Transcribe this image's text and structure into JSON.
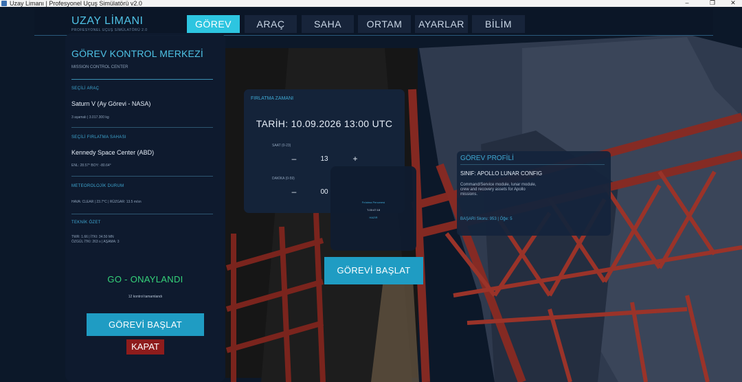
{
  "window": {
    "title": "Uzay Limanı | Profesyonel Uçuş Simülatörü v2.0",
    "controls": {
      "minimize": "–",
      "maximize": "❐",
      "close": "✕"
    }
  },
  "brand": {
    "name": "UZAY LİMANI",
    "subtitle": "PROFESYONEL UÇUŞ SİMÜLATÖRÜ 2.0"
  },
  "nav": {
    "tabs": [
      {
        "label": "GÖREV",
        "active": true
      },
      {
        "label": "ARAÇ",
        "active": false
      },
      {
        "label": "SAHA",
        "active": false
      },
      {
        "label": "ORTAM",
        "active": false
      },
      {
        "label": "AYARLAR",
        "active": false
      },
      {
        "label": "BİLİM",
        "active": false
      }
    ]
  },
  "mission_control": {
    "title": "GÖREV KONTROL MERKEZİ",
    "subtitle": "MISSION CONTROL CENTER",
    "sections": [
      {
        "label": "SEÇİLİ ARAÇ",
        "value": "Saturn V (Ay Görevi - NASA)",
        "detail": "3 aşamalı  |  3.017.300 kg"
      },
      {
        "label": "SEÇİLİ FIRLATMA SAHASI",
        "value": "Kennedy Space Center (ABD)",
        "detail": "ENL: 28.57°  BOY: -80.64°"
      },
      {
        "label": "METEOROLOJİK DURUM",
        "value": "",
        "detail": "HAVA: CLEAR  |  23.7°C  |  RÜZGAR: 13.5 m/sn"
      },
      {
        "label": "TEKNİK ÖZET",
        "value": "",
        "detail": "TWR: 1.66  |  İTKI: 34.50 MN",
        "detail2": "ÖZGÜL İTKI: 263 s  |  AŞAMA: 3"
      }
    ],
    "status": "GO - ONAYLANDI",
    "checks": "12 kontrol tamamlandı",
    "start_button": "GÖREVİ BAŞLAT",
    "close_button": "KAPAT"
  },
  "launch_time": {
    "label": "FIRLATMA ZAMANI",
    "date_text": "TARİH:  10.09.2026  13:00 UTC",
    "hour_label": "SAAT (0-23)",
    "hour_value": "13",
    "minute_label": "DAKİKA (0-59)",
    "minute_value": "00",
    "decrement": "–",
    "increment": "+"
  },
  "countdown": {
    "line1": "Fırlatma Penceresi",
    "line2": "T-00:47:18",
    "line3": "HAZIR"
  },
  "start_mission_button": "GÖREVİ BAŞLAT",
  "mission_profile": {
    "title": "GÖREV PROFİLİ",
    "class_text": "SINIF: APOLLO LUNAR CONFIG",
    "description": "Command/Service module, lunar module, crew and recovery assets for Apollo missions.",
    "stats": "BAŞARI Skoru: 953  |  Öğe: 5"
  },
  "colors": {
    "accent": "#2dc5e0",
    "panel": "#0e1b2e",
    "go_green": "#35d37a",
    "close_red": "#8e1c1c",
    "label_blue": "#3fa9d4",
    "tower_red": "#8a2a22"
  }
}
